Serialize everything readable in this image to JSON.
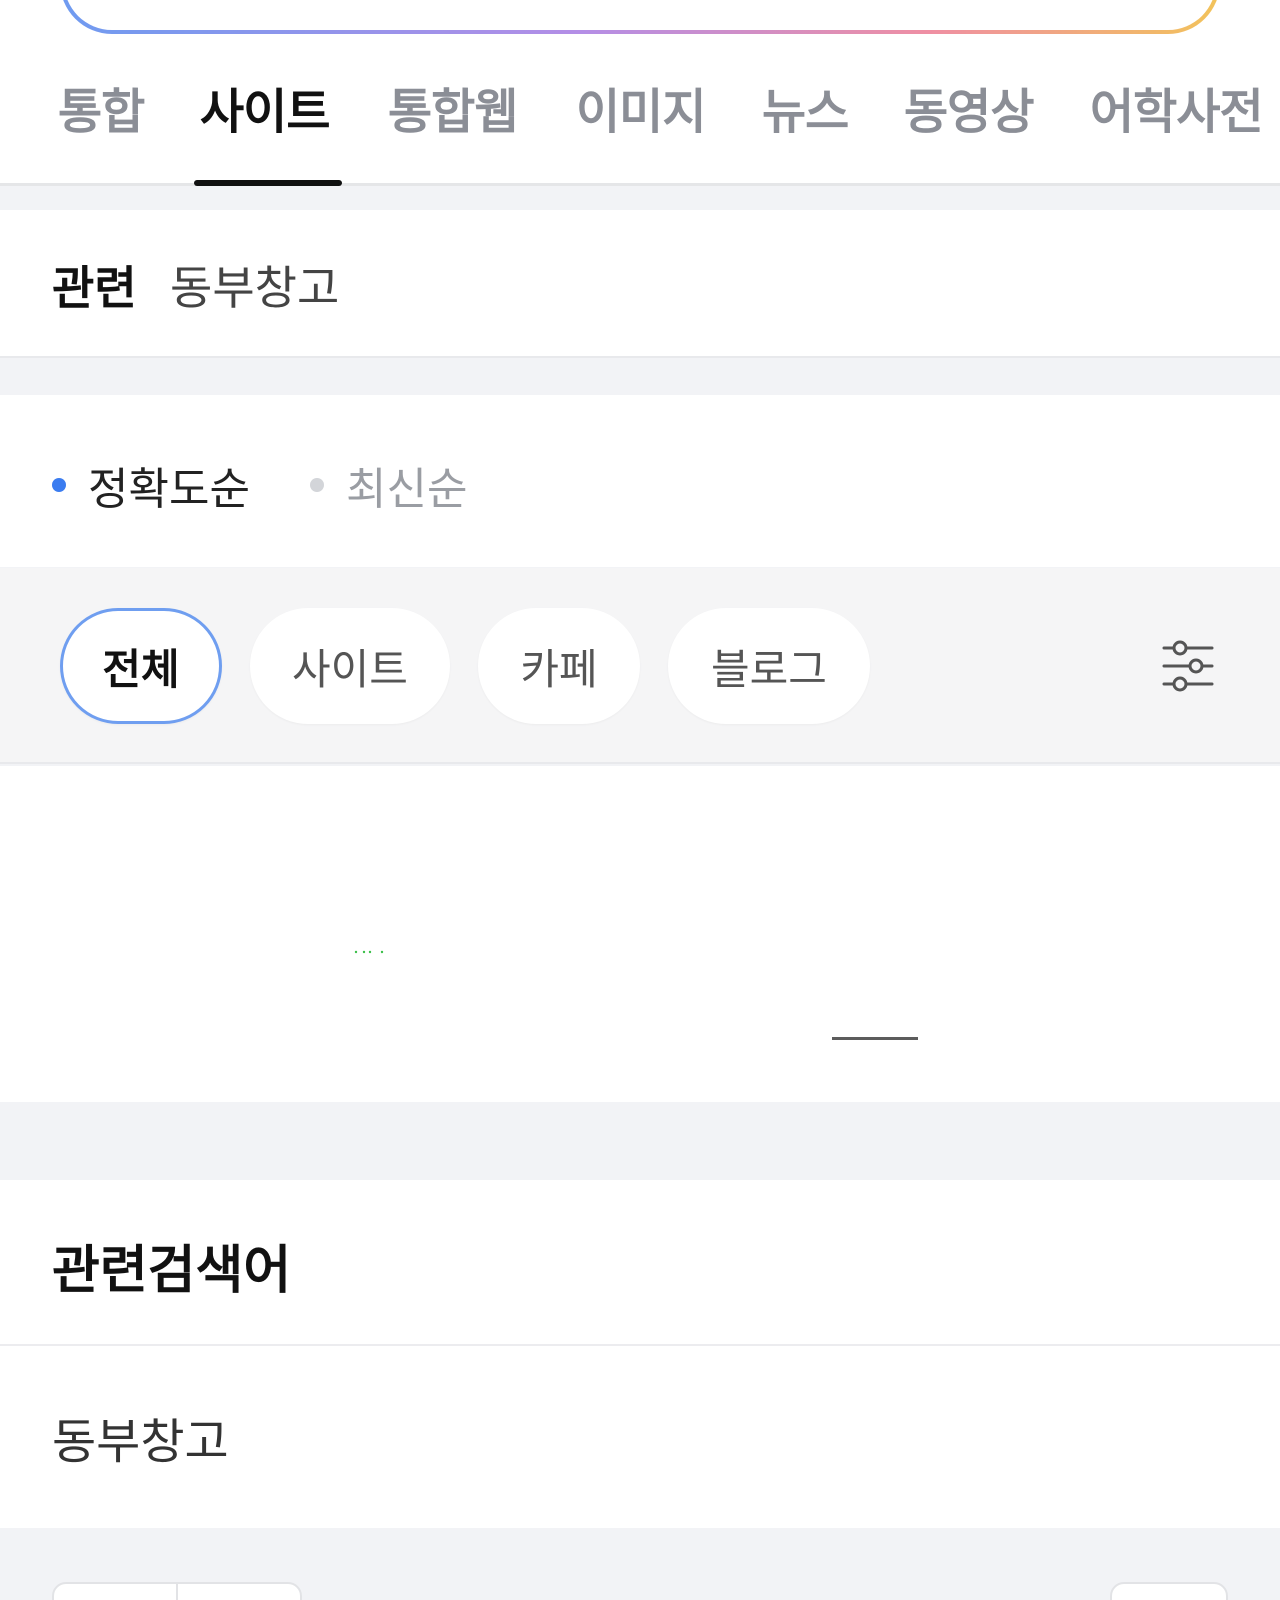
{
  "tabs": {
    "items": [
      {
        "label": "통합"
      },
      {
        "label": "사이트"
      },
      {
        "label": "통합웹"
      },
      {
        "label": "이미지"
      },
      {
        "label": "뉴스"
      },
      {
        "label": "동영상"
      },
      {
        "label": "어학사전"
      }
    ],
    "active_index": 1
  },
  "related": {
    "title": "관련",
    "keyword": "동부창고"
  },
  "sort": {
    "options": [
      {
        "label": "정확도순",
        "selected": true
      },
      {
        "label": "최신순",
        "selected": false
      }
    ]
  },
  "filters": {
    "chips": [
      {
        "label": "전체",
        "selected": true
      },
      {
        "label": "사이트",
        "selected": false
      },
      {
        "label": "카페",
        "selected": false
      },
      {
        "label": "블로그",
        "selected": false
      }
    ],
    "settings_icon": "sliders-icon"
  },
  "related_searches": {
    "title": "관련검색어",
    "items": [
      "동부창고"
    ]
  },
  "colors": {
    "accent": "#3b7cf0",
    "chip_active_border": "#6f9ef0",
    "tab_active": "#111111",
    "tab_inactive": "#8b8e96"
  }
}
